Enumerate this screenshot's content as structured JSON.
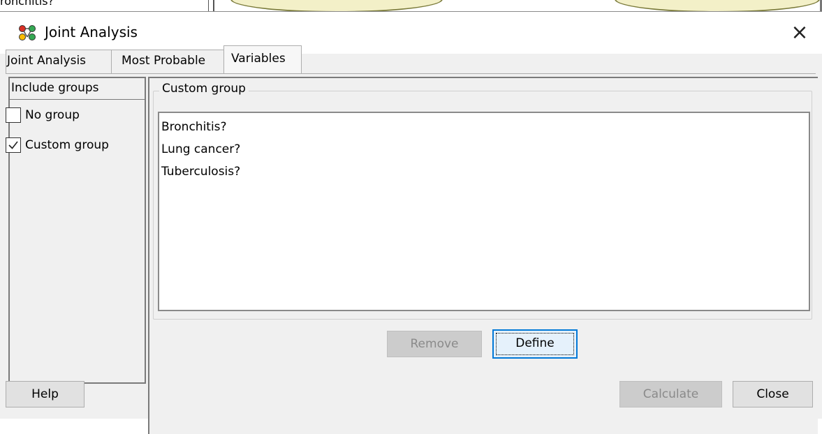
{
  "background": {
    "partial_text": "ronchitis?"
  },
  "dialog": {
    "title": "Joint Analysis",
    "close_glyph": "×",
    "tabs": [
      {
        "label": "Joint Analysis"
      },
      {
        "label": "Most Probable"
      },
      {
        "label": "Variables",
        "selected": true
      }
    ],
    "include_groups": {
      "header": "Include groups",
      "options": [
        {
          "label": "No group",
          "checked": false
        },
        {
          "label": "Custom group",
          "checked": true
        }
      ]
    },
    "custom_group": {
      "legend": "Custom group",
      "items": [
        "Bronchitis?",
        "Lung cancer?",
        "Tuberculosis?"
      ],
      "remove_label": "Remove",
      "define_label": "Define"
    },
    "footer": {
      "help_label": "Help",
      "calculate_label": "Calculate",
      "close_label": "Close"
    }
  },
  "colors": {
    "accent": "#0078d7",
    "dialog_bg": "#f0f0f0",
    "disabled_text": "#8a8a8a"
  },
  "icons": {
    "app_icon": "network-graph-icon",
    "close_icon": "close-icon",
    "check_icon": "checkmark-icon"
  }
}
